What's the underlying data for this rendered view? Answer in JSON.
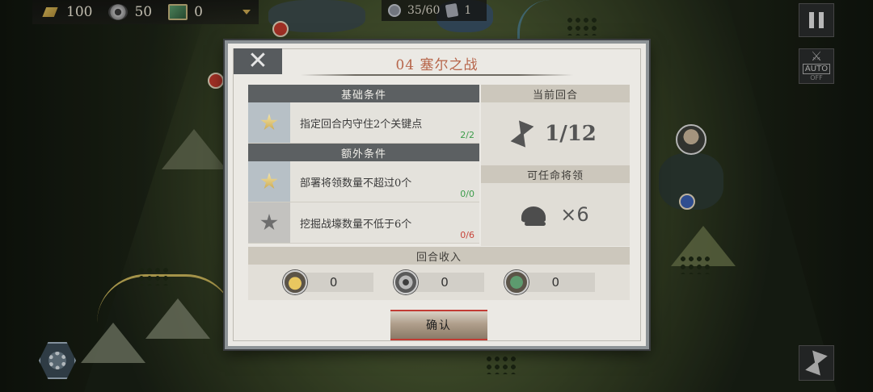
{
  "resources": {
    "gold": "100",
    "industry": "50",
    "tech": "0"
  },
  "army": {
    "units": "35/60",
    "cards": "1"
  },
  "controls": {
    "auto_label": "AUTO",
    "auto_state": "OFF"
  },
  "dialog": {
    "close_symbol": "✕",
    "title": "04 塞尔之战",
    "basic_header": "基础条件",
    "basic_conditions": [
      {
        "text": "指定回合内守住2个关键点",
        "progress": "2/2",
        "achieved": true
      }
    ],
    "extra_header": "额外条件",
    "extra_conditions": [
      {
        "text": "部署将领数量不超过0个",
        "progress": "0/0",
        "achieved": true
      },
      {
        "text": "挖掘战壕数量不低于6个",
        "progress": "0/6",
        "achieved": false
      }
    ],
    "turn_header": "当前回合",
    "turn_value": "1/12",
    "commander_header": "可任命将领",
    "commander_value": "×6",
    "income_header": "回合收入",
    "income": [
      {
        "icon": "gold-icon",
        "value": "0"
      },
      {
        "icon": "industry-icon",
        "value": "0"
      },
      {
        "icon": "tech-icon",
        "value": "0"
      }
    ],
    "confirm_label": "确认"
  },
  "colors": {
    "title": "#b7654a",
    "progress_ok": "#3c9c4a",
    "progress_fail": "#c8443a",
    "confirm_accent": "#c23c34"
  }
}
